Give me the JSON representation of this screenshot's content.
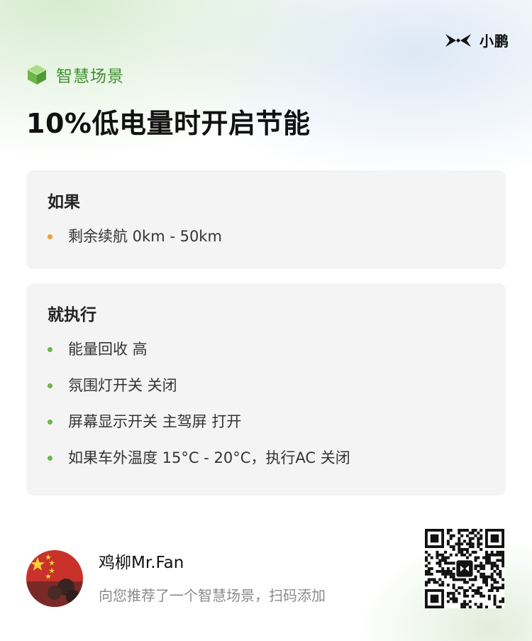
{
  "brand": {
    "name": "小鹏",
    "logo_icon": "xpeng-logo-icon"
  },
  "tag": {
    "label": "智慧场景",
    "icon": "cube-icon"
  },
  "title": "10%低电量时开启节能",
  "if_card": {
    "heading": "如果",
    "items": [
      "剩余续航 0km - 50km"
    ],
    "bullet_color": "#f0a130"
  },
  "then_card": {
    "heading": "就执行",
    "items": [
      "能量回收 高",
      "氛围灯开关 关闭",
      "屏幕显示开关 主驾屏 打开",
      "如果车外温度 15°C - 20°C，执行AC 关闭"
    ],
    "bullet_color": "#6fb64b"
  },
  "user": {
    "name": "鸡柳Mr.Fan",
    "message": "向您推荐了一个智慧场景，扫码添加",
    "avatar_icon": "avatar-flag-icon"
  },
  "qr": {
    "icon": "qr-code-icon"
  },
  "colors": {
    "accent_green": "#3f8f2e",
    "bullet_orange": "#f0a130",
    "bullet_green": "#6fb64b",
    "card_bg": "#f3f3f3"
  }
}
